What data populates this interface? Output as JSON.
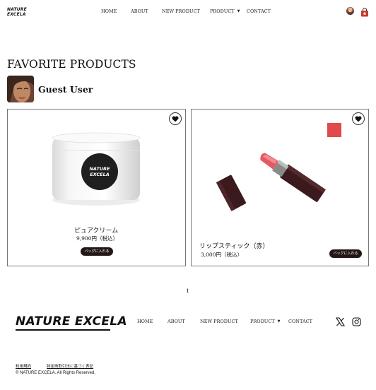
{
  "header": {
    "logo_line1": "NATURE",
    "logo_line2": "EXCELA",
    "nav": {
      "home": "HOME",
      "about": "ABOUT",
      "new_product": "NEW PRODUCT",
      "product": "PRODUCT",
      "contact": "CONTACT"
    }
  },
  "main": {
    "title": "FAVORITE PRODUCTS",
    "user_name": "Guest User",
    "products": [
      {
        "name": "ピュアクリーム",
        "price": "9,900円（税込）",
        "jar_label_line1": "NATURE",
        "jar_label_line2": "EXCELA",
        "add_to_bag": "バッグに入れる"
      },
      {
        "name": "リップスティック（赤）",
        "price": "3,000円（税込）",
        "swatch_color": "#e04a4d",
        "add_to_bag": "バッグに入れる"
      }
    ],
    "pagination": {
      "current": "1"
    }
  },
  "footer": {
    "logo": "NATURE EXCELA",
    "nav": {
      "home": "HOME",
      "about": "ABOUT",
      "new_product": "NEW PRODUCT",
      "product": "PRODUCT",
      "contact": "CONTACT"
    },
    "links": {
      "terms": "利用規約",
      "commerce_law": "特定商取引法に基づく表記"
    },
    "copyright": "© NATURE EXCELA. All Rights Reserved."
  },
  "colors": {
    "text": "#111111",
    "button_dark": "#231815",
    "accent_red": "#e04a4d"
  },
  "icons": {
    "favorite": "heart-icon",
    "cart": "shopping-bag-icon",
    "x": "x-logo-icon",
    "instagram": "instagram-icon"
  }
}
